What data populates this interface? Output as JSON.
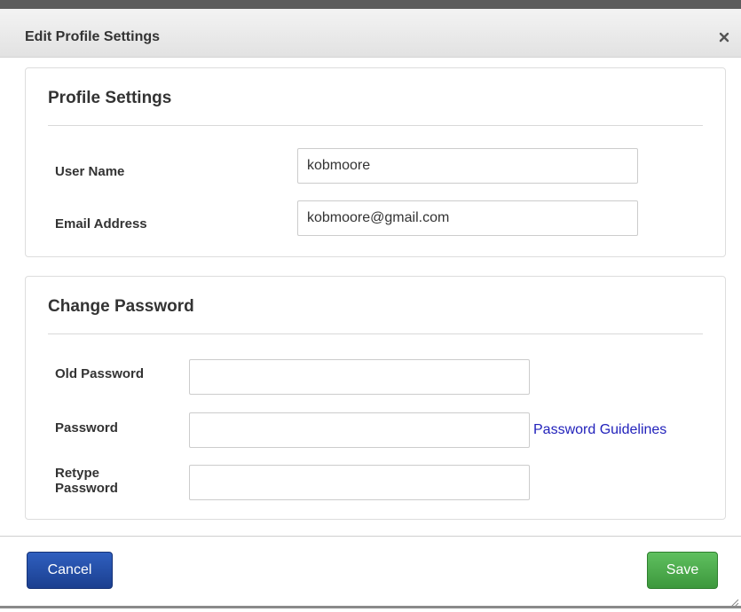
{
  "dialog": {
    "title": "Edit Profile Settings",
    "close_icon": "close-icon"
  },
  "profile": {
    "heading": "Profile Settings",
    "username_label": "User Name",
    "username_value": "kobmoore",
    "email_label": "Email Address",
    "email_value": "kobmoore@gmail.com"
  },
  "password": {
    "heading": "Change Password",
    "old_label": "Old Password",
    "old_value": "",
    "new_label": "Password",
    "new_value": "",
    "guidelines_link": "Password Guidelines",
    "retype_label": "Retype Password",
    "retype_value": ""
  },
  "footer": {
    "cancel_label": "Cancel",
    "save_label": "Save"
  },
  "colors": {
    "cancel_button": "#2a55b0",
    "save_button": "#4cad4c",
    "link": "#2222bb"
  }
}
